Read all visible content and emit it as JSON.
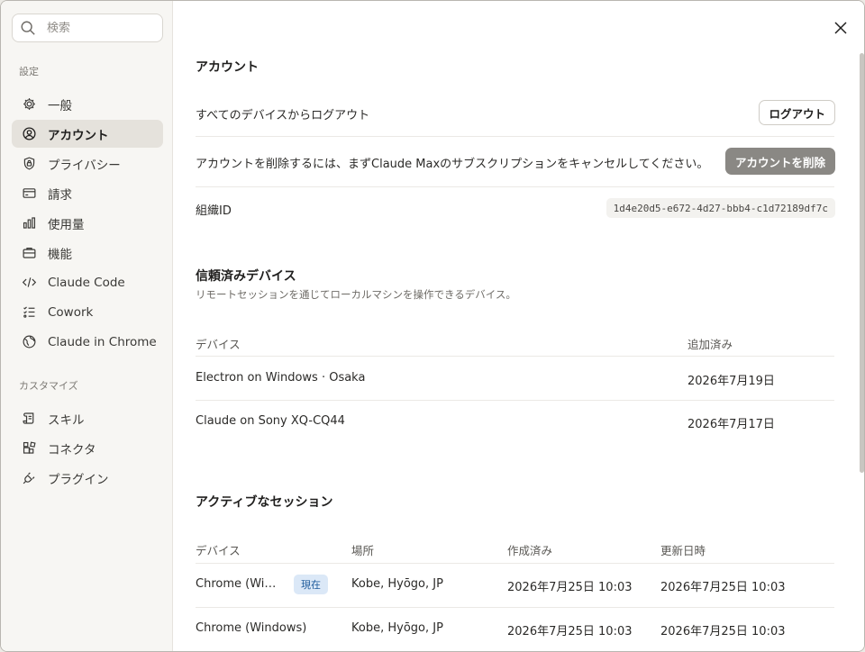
{
  "search": {
    "placeholder": "検索"
  },
  "sidebar": {
    "settings_label": "設定",
    "customize_label": "カスタマイズ",
    "items": [
      {
        "label": "一般",
        "icon": "gear-icon"
      },
      {
        "label": "アカウント",
        "icon": "user-circle-icon"
      },
      {
        "label": "プライバシー",
        "icon": "shield-lock-icon"
      },
      {
        "label": "請求",
        "icon": "credit-card-icon"
      },
      {
        "label": "使用量",
        "icon": "bar-chart-icon"
      },
      {
        "label": "機能",
        "icon": "briefcase-icon"
      },
      {
        "label": "Claude Code",
        "icon": "code-icon"
      },
      {
        "label": "Cowork",
        "icon": "checklist-icon"
      },
      {
        "label": "Claude in Chrome",
        "icon": "globe-icon"
      }
    ],
    "custom_items": [
      {
        "label": "スキル",
        "icon": "scroll-icon"
      },
      {
        "label": "コネクタ",
        "icon": "blocks-icon"
      },
      {
        "label": "プラグイン",
        "icon": "plug-icon"
      }
    ],
    "active_index": 1
  },
  "account": {
    "title": "アカウント",
    "logout_text": "すべてのデバイスからログアウト",
    "logout_button": "ログアウト",
    "delete_text": "アカウントを削除するには、まずClaude Maxのサブスクリプションをキャンセルしてください。",
    "delete_button": "アカウントを削除",
    "org_label": "組織ID",
    "org_id": "1d4e20d5-e672-4d27-bbb4-c1d72189df7c"
  },
  "trusted": {
    "title": "信頼済みデバイス",
    "subtitle": "リモートセッションを通じてローカルマシンを操作できるデバイス。",
    "headers": [
      "デバイス",
      "追加済み"
    ],
    "rows": [
      {
        "device": "Electron on Windows · Osaka",
        "added": "2026年7月19日"
      },
      {
        "device": "Claude on Sony XQ-CQ44",
        "added": "2026年7月17日"
      }
    ]
  },
  "sessions": {
    "title": "アクティブなセッション",
    "headers": [
      "デバイス",
      "場所",
      "作成済み",
      "更新日時"
    ],
    "current_badge": "現在",
    "rows": [
      {
        "device": "Chrome (Wi…",
        "location": "Kobe, Hyōgo, JP",
        "created": "2026年7月25日 10:03",
        "updated": "2026年7月25日 10:03"
      },
      {
        "device": "Chrome (Windows)",
        "location": "Kobe, Hyōgo, JP",
        "created": "2026年7月25日 10:03",
        "updated": "2026年7月25日 10:03"
      }
    ]
  },
  "colors": {
    "accent_badge": "#dbe8f7",
    "danger_button": "#8a8884"
  }
}
